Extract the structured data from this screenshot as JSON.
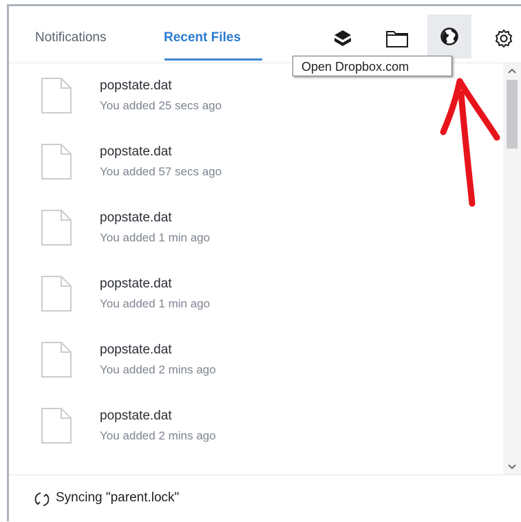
{
  "header": {
    "tabs": [
      {
        "label": "Notifications",
        "active": false
      },
      {
        "label": "Recent Files",
        "active": true
      }
    ],
    "buttons": {
      "dropbox": "dropbox-icon",
      "folder": "folder-icon",
      "globe": "globe-icon",
      "settings": "gear-icon"
    }
  },
  "tooltip": {
    "text": "Open Dropbox.com"
  },
  "files": [
    {
      "name": "popstate.dat",
      "time": "You added 25 secs ago"
    },
    {
      "name": "popstate.dat",
      "time": "You added 57 secs ago"
    },
    {
      "name": "popstate.dat",
      "time": "You added 1 min ago"
    },
    {
      "name": "popstate.dat",
      "time": "You added 1 min ago"
    },
    {
      "name": "popstate.dat",
      "time": "You added 2 mins ago"
    },
    {
      "name": "popstate.dat",
      "time": "You added 2 mins ago"
    }
  ],
  "footer": {
    "status": "Syncing \"parent.lock\""
  },
  "colors": {
    "accent": "#2a7ad0",
    "annotation_arrow": "#e8141c"
  }
}
